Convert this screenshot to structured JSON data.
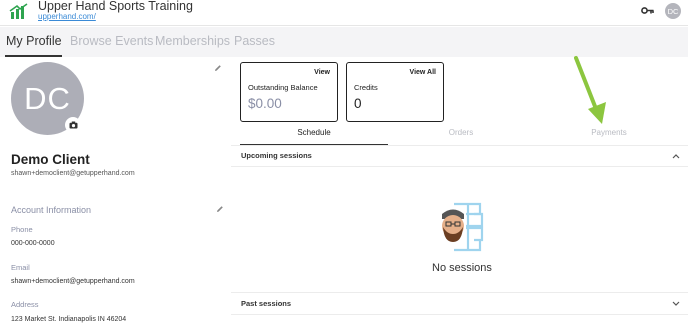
{
  "brand": {
    "title": "Upper Hand Sports Training",
    "url": "upperhand.com/"
  },
  "header": {
    "avatar_initials": "DC",
    "key_icon": "key-icon"
  },
  "nav": {
    "tabs": [
      {
        "label": "My Profile",
        "active": true
      },
      {
        "label": "Browse Events",
        "active": false
      },
      {
        "label": "Memberships",
        "active": false
      },
      {
        "label": "Passes",
        "active": false
      }
    ]
  },
  "profile": {
    "initials": "DC",
    "name": "Demo Client",
    "email": "shawn+democlient@getupperhand.com",
    "account_info": {
      "title": "Account Information",
      "fields": [
        {
          "label": "Phone",
          "value": "000-000-0000"
        },
        {
          "label": "Email",
          "value": "shawn+democlient@getupperhand.com"
        },
        {
          "label": "Address",
          "value": "123 Market St. Indianapolis IN 46204"
        }
      ]
    }
  },
  "cards": {
    "balance": {
      "label": "Outstanding Balance",
      "value": "$0.00",
      "link": "View",
      "value_color": "#8a8fa6"
    },
    "credits": {
      "label": "Credits",
      "value": "0",
      "link": "View All"
    }
  },
  "section_tabs": [
    {
      "label": "Schedule",
      "active": true
    },
    {
      "label": "Orders",
      "active": false
    },
    {
      "label": "Payments",
      "active": false
    }
  ],
  "sessions": {
    "upcoming_title": "Upcoming sessions",
    "empty_text": "No sessions",
    "past_title": "Past sessions"
  },
  "colors": {
    "accent_link": "#3a8ad6",
    "annotation_arrow": "#8cc63f",
    "logo_green": "#2ea44f"
  }
}
